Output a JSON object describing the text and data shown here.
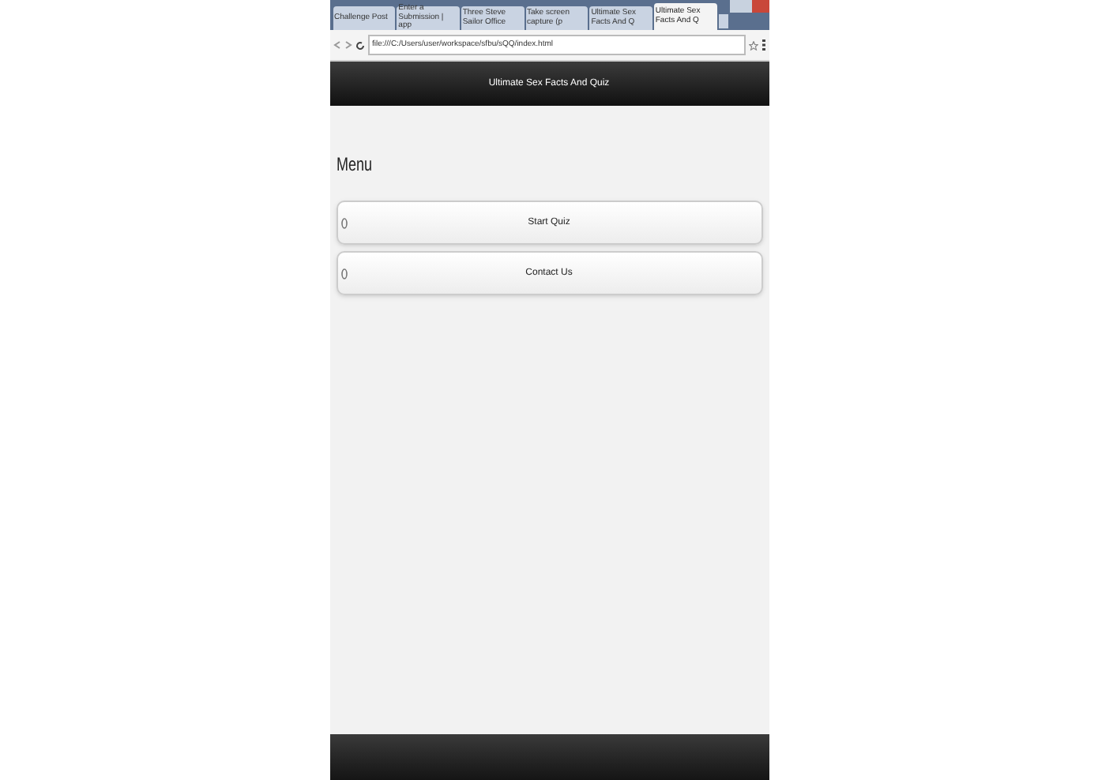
{
  "browser": {
    "tabs": [
      {
        "title": "Challenge Post",
        "selected": false
      },
      {
        "title": "Enter a Submission | app",
        "selected": false
      },
      {
        "title": "Three Steve Sailor Office",
        "selected": false
      },
      {
        "title": "Take screen capture (p",
        "selected": false
      },
      {
        "title": "Ultimate Sex Facts And Q",
        "selected": false
      },
      {
        "title": "Ultimate Sex Facts And Q",
        "selected": true
      }
    ],
    "url": "file:///C:/Users/user/workspace/sfbu/sQQ/index.html"
  },
  "header": {
    "title": "Ultimate Sex Facts And Quiz"
  },
  "content": {
    "heading": "Menu",
    "buttons": [
      "Start Quiz",
      "Contact Us"
    ]
  }
}
